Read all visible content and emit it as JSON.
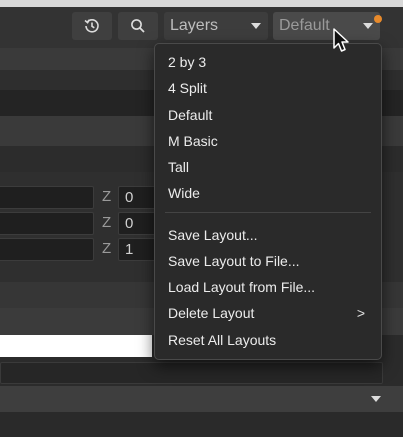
{
  "toolbar": {
    "history_icon": "history-icon",
    "search_icon": "search-icon",
    "panel_dropdown": {
      "value": "Layers"
    },
    "layout_dropdown": {
      "value": "Default"
    },
    "indicator_color": "#e88a2b"
  },
  "transform": {
    "rows": [
      {
        "axis": "Z",
        "value": "0"
      },
      {
        "axis": "Z",
        "value": "0"
      },
      {
        "axis": "Z",
        "value": "1"
      }
    ]
  },
  "layout_menu": {
    "presets": [
      "2 by 3",
      "4 Split",
      "Default",
      "M Basic",
      "Tall",
      "Wide"
    ],
    "actions": {
      "save_layout": "Save Layout...",
      "save_layout_to_file": "Save Layout to File...",
      "load_layout_from_file": "Load Layout from File...",
      "delete_layout": "Delete Layout",
      "reset_all_layouts": "Reset All Layouts"
    },
    "submenu_arrow": ">"
  }
}
